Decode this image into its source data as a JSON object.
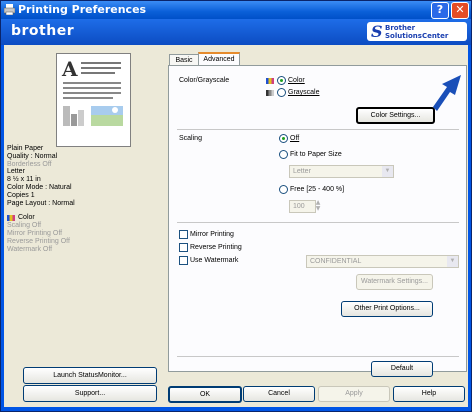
{
  "window": {
    "title": "Printing Preferences",
    "help_glyph": "?",
    "close_glyph": "✕"
  },
  "brand": {
    "logo": "brother",
    "solutions_line1": "Brother",
    "solutions_line2": "SolutionsCenter"
  },
  "summary": {
    "lines": [
      "Plain Paper",
      "Quality : Normal",
      "Borderless Off",
      "Letter",
      "8 ½ x 11 in",
      "Color Mode : Natural",
      "Copies 1",
      "Page Layout : Normal"
    ],
    "dim_index": 2,
    "color_label": "Color",
    "color_lines": [
      "Scaling Off",
      "Mirror Printing Off",
      "Reverse Printing Off",
      "Watermark Off"
    ]
  },
  "left_buttons": {
    "launch": "Launch StatusMonitor...",
    "support": "Support..."
  },
  "tabs": [
    {
      "label": "Basic"
    },
    {
      "label": "Advanced"
    }
  ],
  "color_grayscale": {
    "label": "Color/Grayscale",
    "options": [
      "Color",
      "Grayscale"
    ],
    "selected": "Color",
    "settings_button": "Color Settings..."
  },
  "scaling": {
    "label": "Scaling",
    "off": "Off",
    "fit": "Fit to Paper Size",
    "fit_value": "Letter",
    "free": "Free [25 - 400 %]",
    "free_value": "100",
    "selected": "Off"
  },
  "checks": {
    "mirror": "Mirror Printing",
    "reverse": "Reverse Printing",
    "watermark": "Use Watermark"
  },
  "watermark": {
    "value": "CONFIDENTIAL",
    "settings_button": "Watermark Settings..."
  },
  "other_button": "Other Print Options...",
  "default_button": "Default",
  "bottom": {
    "ok": "OK",
    "cancel": "Cancel",
    "apply": "Apply",
    "help": "Help"
  },
  "colors": {
    "accent": "#0055e5",
    "arrow": "#1a4fb8",
    "titlebar": "#0a5fd8"
  }
}
